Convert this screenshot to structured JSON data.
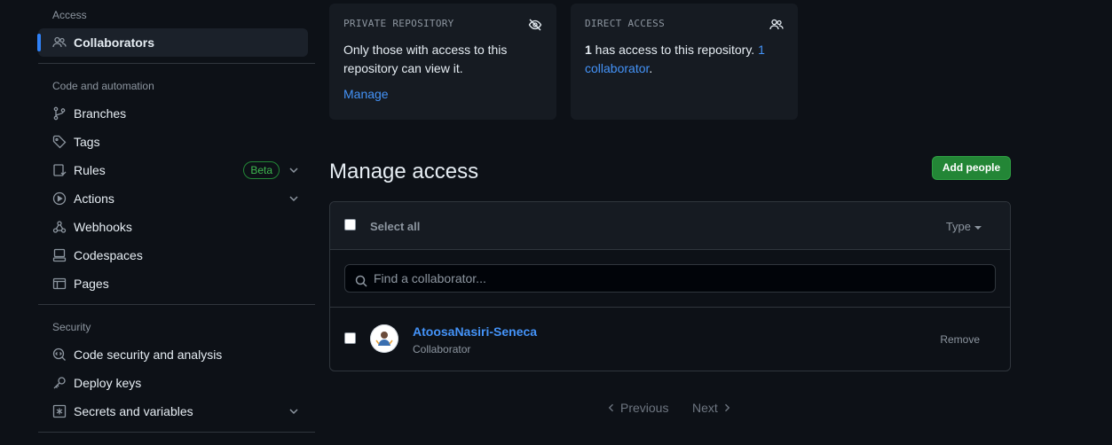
{
  "sidebar": {
    "access_title": "Access",
    "collaborators": "Collaborators",
    "code_title": "Code and automation",
    "branches": "Branches",
    "tags": "Tags",
    "rules": "Rules",
    "rules_badge": "Beta",
    "actions": "Actions",
    "webhooks": "Webhooks",
    "codespaces": "Codespaces",
    "pages": "Pages",
    "security_title": "Security",
    "code_security": "Code security and analysis",
    "deploy_keys": "Deploy keys",
    "secrets": "Secrets and variables"
  },
  "private_card": {
    "title": "PRIVATE REPOSITORY",
    "text": "Only those with access to this repository can view it.",
    "link": "Manage"
  },
  "direct_card": {
    "title": "DIRECT ACCESS",
    "count": "1",
    "text": " has access to this repository. ",
    "link": "1 collaborator",
    "tail": "."
  },
  "manage": {
    "heading": "Manage access",
    "add_button": "Add people",
    "select_all": "Select all",
    "type_filter": "Type",
    "search_placeholder": "Find a collaborator...",
    "collaborators": [
      {
        "name": "AtoosaNasiri-Seneca",
        "role": "Collaborator",
        "action": "Remove"
      }
    ]
  },
  "pagination": {
    "previous": "Previous",
    "next": "Next"
  },
  "colors": {
    "accent": "#2f81f7",
    "link": "#4493f8",
    "success": "#238636",
    "background": "#0d1117",
    "surface": "#161b22"
  }
}
